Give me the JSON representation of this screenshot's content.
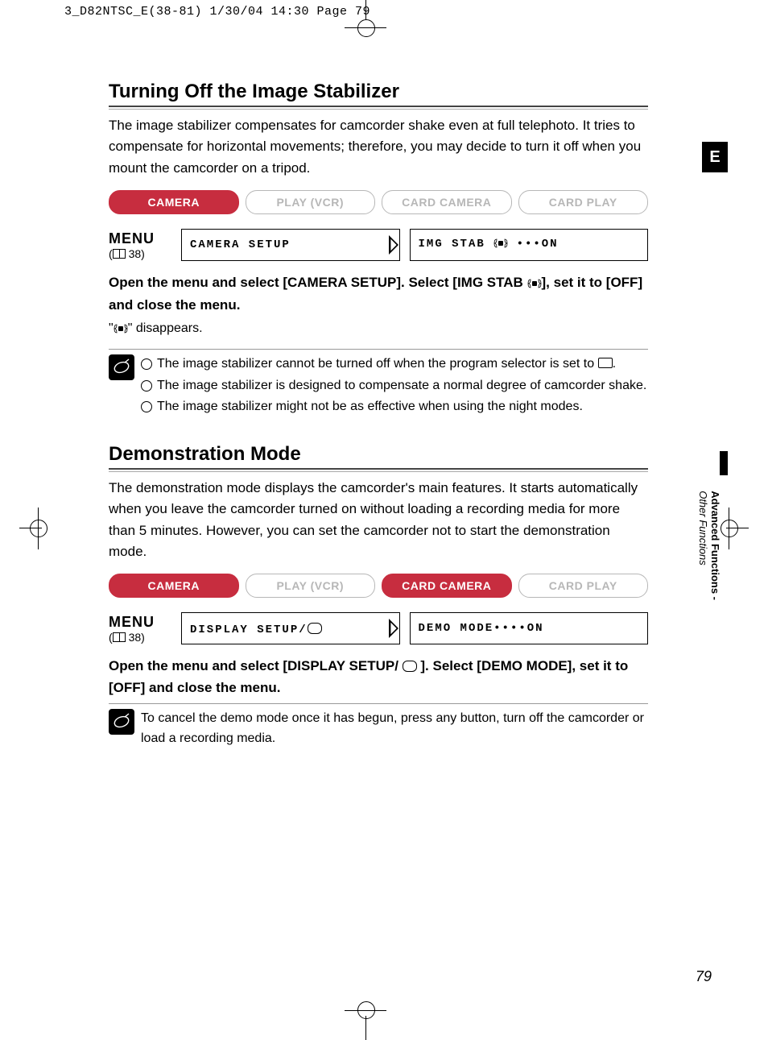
{
  "print_header": "3_D82NTSC_E(38-81)  1/30/04 14:30  Page 79",
  "side_tab": "E",
  "side_caption_bold": "Advanced Functions -",
  "side_caption_italic": "Other Functions",
  "page_number": "79",
  "section1": {
    "title": "Turning Off the Image Stabilizer",
    "body": "The image stabilizer compensates for camcorder shake even at full telephoto. It tries to compensate for horizontal movements; therefore, you may decide to turn it off when you mount the camcorder on a tripod.",
    "modes": {
      "camera": "CAMERA",
      "play_vcr": "PLAY (VCR)",
      "card_camera": "CARD CAMERA",
      "card_play": "CARD PLAY"
    },
    "menu_label": "MENU",
    "menu_ref": "38",
    "menu_left": "CAMERA SETUP",
    "menu_right": "IMG STAB  •••ON",
    "instruction": "Open the menu and select [CAMERA SETUP]. Select [IMG STAB   ], set it to [OFF] and close the menu.",
    "note_line": "\"   \" disappears.",
    "notes": [
      "The image stabilizer cannot be turned off when the program selector is set to   .",
      "The image stabilizer is designed to compensate a normal degree of camcorder shake.",
      "The image stabilizer might not be as effective when using the night modes."
    ]
  },
  "section2": {
    "title": "Demonstration Mode",
    "body": "The demonstration mode displays the camcorder's main features. It starts automatically when you leave the camcorder turned on without loading a recording media for more than 5 minutes. However, you can set the camcorder not to start the demonstration mode.",
    "modes": {
      "camera": "CAMERA",
      "play_vcr": "PLAY (VCR)",
      "card_camera": "CARD CAMERA",
      "card_play": "CARD PLAY"
    },
    "menu_label": "MENU",
    "menu_ref": "38",
    "menu_left": "DISPLAY SETUP/",
    "menu_right": "DEMO MODE••••ON",
    "instruction": "Open the menu and select [DISPLAY SETUP/   ]. Select [DEMO MODE], set it to [OFF] and close the menu.",
    "note": "To cancel the demo mode once it has begun, press any button, turn off the camcorder or load a recording media."
  }
}
